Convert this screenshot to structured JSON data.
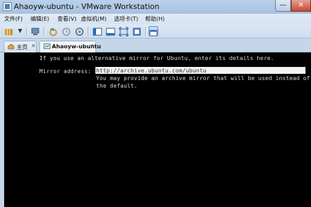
{
  "window": {
    "title": "Ahaoyw-ubuntu - VMware Workstation"
  },
  "menu": [
    "文件(F)",
    "编辑(E)",
    "查看(V)",
    "虚拟机(M)",
    "选项卡(T)",
    "帮助(H)"
  ],
  "tabs": [
    {
      "label": "主页"
    },
    {
      "label": "Ahaoyw-ubuntu"
    }
  ],
  "console": {
    "intro": "If you use an alternative mirror for Ubuntu, enter its details here.",
    "mirror_label": "Mirror address:",
    "mirror_value": "http://archive.ubuntu.com/ubuntu",
    "help_line1": "You may provide an archive mirror that will be used instead of",
    "help_line2": "the default."
  },
  "colors": {
    "titlebar": "#b9d1ea",
    "console_bg": "#000000",
    "console_text": "#d8d8d8",
    "input_bg": "#f2f2f2"
  }
}
